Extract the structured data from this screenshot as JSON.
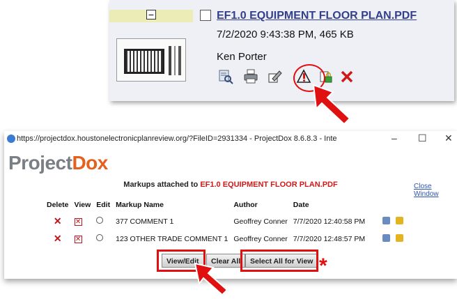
{
  "file_card": {
    "collapse_symbol": "−",
    "file_name": "EF1.0 EQUIPMENT FLOOR PLAN.PDF",
    "date_size": "7/2/2020 9:43:38 PM, 465 KB",
    "author": "Ken Porter",
    "icons": [
      "search-file-icon",
      "print-icon",
      "edit-icon",
      "markup-icon",
      "lock-icon",
      "delete-x-icon"
    ]
  },
  "window": {
    "url_title": "https://projectdox.houstonelectronicplanreview.org/?FileID=2931334 - ProjectDox 8.6.8.3 - Inte",
    "minimize": "–",
    "maximize": "☐",
    "close": "✕",
    "logo_part1": "Project",
    "logo_part2": "Dox",
    "close_window_link": "Close Window",
    "markups_prefix": "Markups attached to ",
    "markups_file": "EF1.0 EQUIPMENT FLOOR PLAN.PDF"
  },
  "table": {
    "headers": [
      "Delete",
      "View",
      "Edit",
      "Markup Name",
      "Author",
      "Date"
    ],
    "rows": [
      {
        "name": "377 COMMENT 1",
        "author": "Geoffrey Conner",
        "date": "7/7/2020 12:40:58 PM"
      },
      {
        "name": "123 OTHER TRADE COMMENT 1",
        "author": "Geoffrey Conner",
        "date": "7/7/2020 12:48:57 PM"
      }
    ]
  },
  "buttons": {
    "view_edit": "View/Edit",
    "clear_all": "Clear All",
    "select_all": "Select All for View"
  },
  "annotation_asterisk": "*",
  "colors": {
    "accent_red": "#e01010",
    "link_blue": "#333f8c",
    "logo_orange": "#e65f1d"
  }
}
